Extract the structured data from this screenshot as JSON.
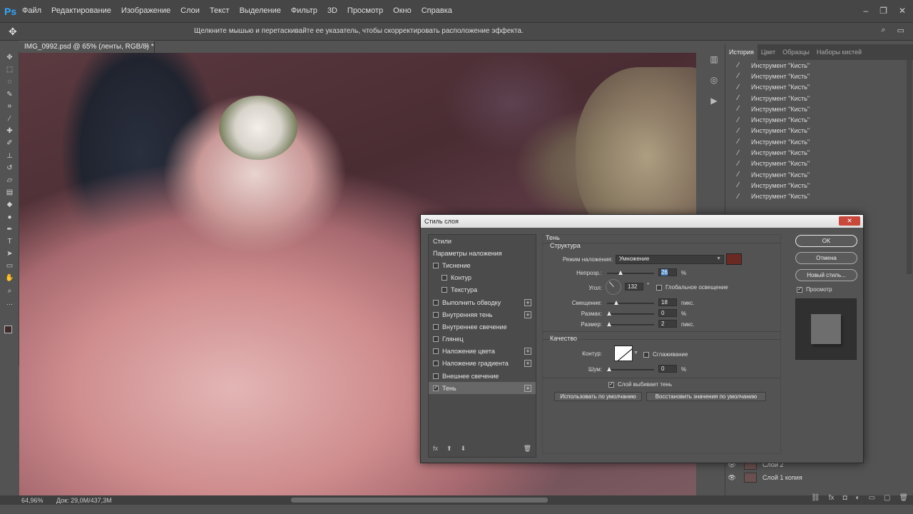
{
  "app": {
    "logo": "Ps"
  },
  "menu": [
    "Файл",
    "Редактирование",
    "Изображение",
    "Слои",
    "Текст",
    "Выделение",
    "Фильтр",
    "3D",
    "Просмотр",
    "Окно",
    "Справка"
  ],
  "options_bar": {
    "hint": "Щелкните мышью и перетаскивайте ее указатель, чтобы скорректировать расположение эффекта."
  },
  "document": {
    "tab_title": "IMG_0992.psd @ 65% (ленты, RGB/8) *",
    "close": "×"
  },
  "status": {
    "zoom": "64,96%",
    "doc": "Док: 29,0M/437,3M"
  },
  "right_panel": {
    "tabs": [
      "История",
      "Цвет",
      "Образцы",
      "Наборы кистей"
    ],
    "history_items": [
      "Инструмент \"Кисть\"",
      "Инструмент \"Кисть\"",
      "Инструмент \"Кисть\"",
      "Инструмент \"Кисть\"",
      "Инструмент \"Кисть\"",
      "Инструмент \"Кисть\"",
      "Инструмент \"Кисть\"",
      "Инструмент \"Кисть\"",
      "Инструмент \"Кисть\"",
      "Инструмент \"Кисть\"",
      "Инструмент \"Кисть\"",
      "Инструмент \"Кисть\"",
      "Инструмент \"Кисть\""
    ],
    "layers": [
      "Слой 2",
      "Слой 1 копия"
    ]
  },
  "dialog": {
    "title": "Стиль слоя",
    "close": "✕",
    "styles_header": "Стили",
    "blending_options": "Параметры наложения",
    "styles": [
      {
        "label": "Тиснение",
        "checked": false,
        "plus": false,
        "sub": false
      },
      {
        "label": "Контур",
        "checked": false,
        "plus": false,
        "sub": true
      },
      {
        "label": "Текстура",
        "checked": false,
        "plus": false,
        "sub": true
      },
      {
        "label": "Выполнить обводку",
        "checked": false,
        "plus": true,
        "sub": false
      },
      {
        "label": "Внутренняя тень",
        "checked": false,
        "plus": true,
        "sub": false
      },
      {
        "label": "Внутреннее свечение",
        "checked": false,
        "plus": false,
        "sub": false
      },
      {
        "label": "Глянец",
        "checked": false,
        "plus": false,
        "sub": false
      },
      {
        "label": "Наложение цвета",
        "checked": false,
        "plus": true,
        "sub": false
      },
      {
        "label": "Наложение градиента",
        "checked": false,
        "plus": true,
        "sub": false
      },
      {
        "label": "Внешнее свечение",
        "checked": false,
        "plus": false,
        "sub": false
      },
      {
        "label": "Тень",
        "checked": true,
        "plus": true,
        "sub": false,
        "selected": true
      }
    ],
    "section_title": "Тень",
    "structure": {
      "title": "Структура",
      "blend_label": "Режим наложения:",
      "blend_value": "Умножение",
      "shadow_color": "#6a2a23",
      "opacity_label": "Непрозр.:",
      "opacity_value": "26",
      "opacity_unit": "%",
      "angle_label": "Угол:",
      "angle_value": "132",
      "angle_unit": "°",
      "global_light": "Глобальное освещение",
      "distance_label": "Смещение:",
      "distance_value": "18",
      "distance_unit": "пикс.",
      "spread_label": "Размах:",
      "spread_value": "0",
      "spread_unit": "%",
      "size_label": "Размер:",
      "size_value": "2",
      "size_unit": "пикс."
    },
    "quality": {
      "title": "Качество",
      "contour_label": "Контур:",
      "antialias": "Сглаживание",
      "noise_label": "Шум:",
      "noise_value": "0",
      "noise_unit": "%"
    },
    "knockout": "Слой выбивает тень",
    "make_default": "Использовать по умолчанию",
    "reset_default": "Восстановить значения по умолчанию",
    "buttons": {
      "ok": "OK",
      "cancel": "Отмена",
      "new_style": "Новый стиль...",
      "preview": "Просмотр"
    }
  }
}
